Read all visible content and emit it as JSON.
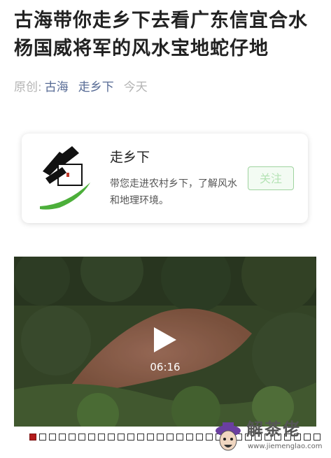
{
  "article": {
    "title": "古海带你走乡下去看广东信宜合水杨国威将军的风水宝地蛇仔地",
    "meta": {
      "original_label": "原创:",
      "author": "古海",
      "source": "走乡下",
      "date": "今天"
    }
  },
  "account_card": {
    "name": "走乡下",
    "description": "带您走进农村乡下，了解风水和地理环境。",
    "follow_label": "关注"
  },
  "video": {
    "duration": "06:16",
    "progress": 0.04
  },
  "watermark": {
    "name": "解茶佬",
    "url": "www.jiemenglao.com"
  },
  "colors": {
    "title": "#222222",
    "link": "#576b95",
    "muted": "#b3b3b3",
    "follow_green": "#9fd39f"
  }
}
